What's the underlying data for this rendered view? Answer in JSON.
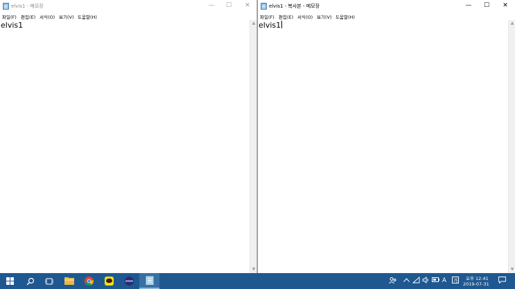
{
  "windows": {
    "left": {
      "title": "elvis1 - 메모장",
      "content": "elvis1",
      "controls": {
        "minimize": "—",
        "maximize": "☐",
        "close": "✕"
      }
    },
    "right": {
      "title": "elvis1 - 복사본 - 메모장",
      "content": "elvis1",
      "controls": {
        "minimize": "—",
        "maximize": "☐",
        "close": "✕"
      }
    }
  },
  "menu": {
    "file": "파일(F)",
    "edit": "편집(E)",
    "format": "서식(O)",
    "view": "보기(V)",
    "help": "도움말(H)"
  },
  "taskbar": {
    "apps": [
      "start-icon",
      "search-icon",
      "task-view-icon",
      "file-explorer-icon",
      "chrome-icon",
      "kakaotalk-icon",
      "app-icon",
      "notepad-icon"
    ],
    "clock": {
      "time": "오후 12:41",
      "date": "2019-07-31"
    },
    "ime": "A",
    "colors": {
      "taskbar": "#1f5891",
      "active": "#3a6fa3"
    }
  }
}
